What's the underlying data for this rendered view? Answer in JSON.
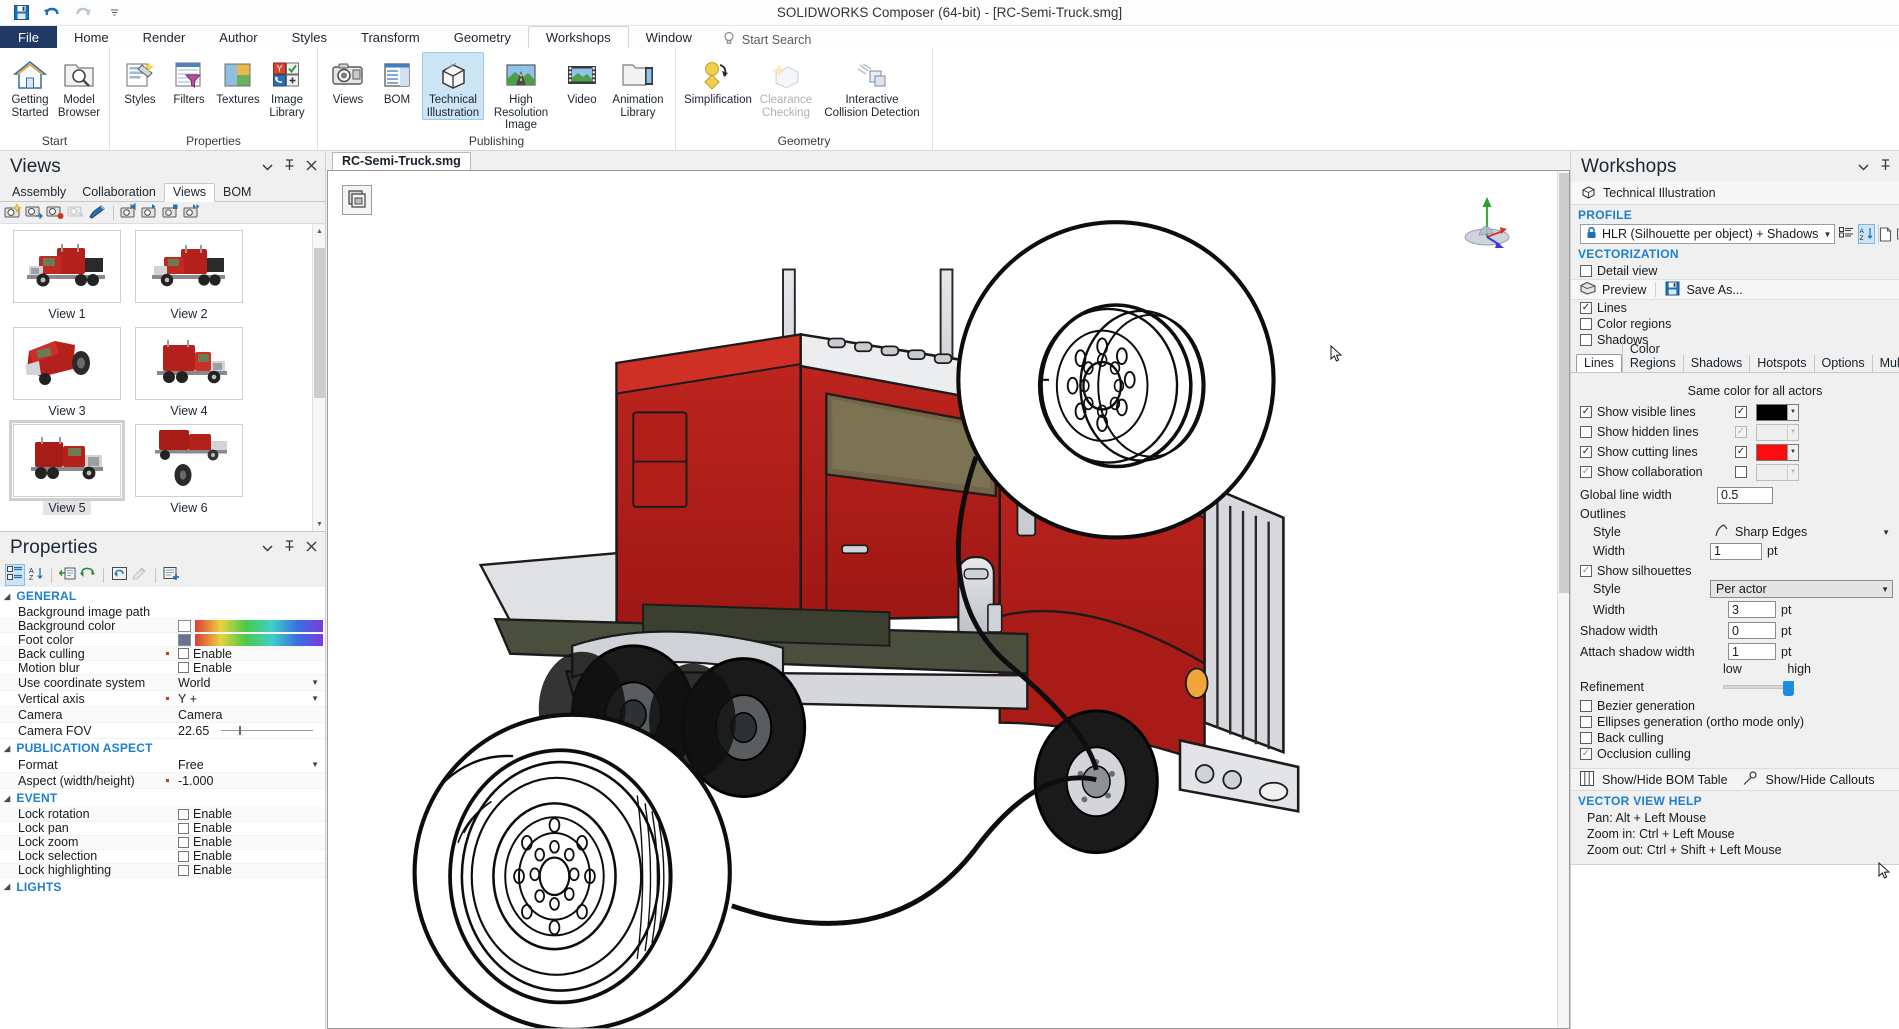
{
  "app": {
    "title": "SOLIDWORKS Composer (64-bit) - [RC-Semi-Truck.smg]",
    "quick_access": [
      "save-icon",
      "undo-icon",
      "redo-icon",
      "customize-qat-icon"
    ]
  },
  "ribbon": {
    "tabs": [
      {
        "label": "File",
        "type": "file"
      },
      {
        "label": "Home"
      },
      {
        "label": "Render"
      },
      {
        "label": "Author"
      },
      {
        "label": "Styles"
      },
      {
        "label": "Transform"
      },
      {
        "label": "Geometry"
      },
      {
        "label": "Workshops",
        "active": true
      },
      {
        "label": "Window"
      }
    ],
    "search_placeholder": "Start Search",
    "groups": [
      {
        "label": "Start",
        "buttons": [
          {
            "label": "Getting\nStarted",
            "icon": "home-icon",
            "selected": false,
            "disabled": false
          },
          {
            "label": "Model\nBrowser",
            "icon": "folder-search-icon",
            "selected": false,
            "disabled": false
          }
        ]
      },
      {
        "label": "Properties",
        "buttons": [
          {
            "label": "Styles",
            "icon": "styles-icon",
            "selected": false,
            "disabled": false
          },
          {
            "label": "Filters",
            "icon": "filters-icon",
            "selected": false,
            "disabled": false
          },
          {
            "label": "Textures",
            "icon": "textures-icon",
            "selected": false,
            "disabled": false
          },
          {
            "label": "Image\nLibrary",
            "icon": "image-library-icon",
            "selected": false,
            "disabled": false
          }
        ]
      },
      {
        "label": "Publishing",
        "buttons": [
          {
            "label": "Views",
            "icon": "camera-icon",
            "selected": false,
            "disabled": false
          },
          {
            "label": "BOM",
            "icon": "bom-icon",
            "selected": false,
            "disabled": false
          },
          {
            "label": "Technical\nIllustration",
            "icon": "technical-illustration-icon",
            "selected": true,
            "disabled": false
          },
          {
            "label": "High Resolution\nImage",
            "icon": "high-res-image-icon",
            "selected": false,
            "disabled": false
          },
          {
            "label": "Video",
            "icon": "video-icon",
            "selected": false,
            "disabled": false
          },
          {
            "label": "Animation\nLibrary",
            "icon": "animation-library-icon",
            "selected": false,
            "disabled": false
          }
        ]
      },
      {
        "label": "Geometry",
        "buttons": [
          {
            "label": "Simplification",
            "icon": "simplification-icon",
            "selected": false,
            "disabled": false
          },
          {
            "label": "Clearance\nChecking",
            "icon": "clearance-checking-icon",
            "selected": false,
            "disabled": true
          },
          {
            "label": "Interactive\nCollision Detection",
            "icon": "collision-detection-icon",
            "selected": false,
            "disabled": true
          }
        ]
      }
    ]
  },
  "views_panel": {
    "title": "Views",
    "tabs": [
      {
        "label": "Assembly",
        "active": false
      },
      {
        "label": "Collaboration",
        "active": false
      },
      {
        "label": "Views",
        "active": true
      },
      {
        "label": "BOM",
        "active": false
      }
    ],
    "toolbar": [
      "create-view-icon",
      "update-view-icon",
      "record-view-icon",
      "refresh-view-icon",
      "paint-view-icon",
      "first-view-icon",
      "previous-view-icon",
      "stop-view-icon",
      "next-view-icon"
    ],
    "thumbnails": [
      {
        "label": "View 1",
        "selected": false,
        "kind": "truck-front-quarter"
      },
      {
        "label": "View 2",
        "selected": false,
        "kind": "truck-front-quarter"
      },
      {
        "label": "View 3",
        "selected": false,
        "kind": "truck-with-wheel-off"
      },
      {
        "label": "View 4",
        "selected": false,
        "kind": "truck-side"
      },
      {
        "label": "View 5",
        "selected": true,
        "kind": "truck-rear-quarter"
      },
      {
        "label": "View 6",
        "selected": false,
        "kind": "truck-with-tire"
      }
    ]
  },
  "properties_panel": {
    "title": "Properties",
    "toolbar": [
      "group-by-category-icon",
      "sort-alpha-icon",
      "import-properties-icon",
      "refresh-properties-icon",
      "restore-default-icon",
      "eyedropper-icon",
      "add-property-icon"
    ],
    "groups": [
      {
        "name": "GENERAL",
        "rows": [
          {
            "name": "Background image path",
            "value": "",
            "type": "text",
            "modified": false
          },
          {
            "name": "Background color",
            "value": "",
            "type": "color",
            "swatch": "#ffffff",
            "modified": false
          },
          {
            "name": "Foot color",
            "value": "",
            "type": "color",
            "swatch": "#6b7190",
            "modified": false
          },
          {
            "name": "Back culling",
            "value": "Enable",
            "type": "checkbox",
            "checked": false,
            "modified": true
          },
          {
            "name": "Motion blur",
            "value": "Enable",
            "type": "checkbox",
            "checked": false,
            "modified": false
          },
          {
            "name": "Use coordinate system",
            "value": "World",
            "type": "dropdown",
            "modified": false
          },
          {
            "name": "Vertical axis",
            "value": "Y +",
            "type": "dropdown",
            "modified": true
          },
          {
            "name": "Camera",
            "value": "Camera",
            "type": "text",
            "modified": false
          },
          {
            "name": "Camera FOV",
            "value": "22.65",
            "type": "slider",
            "modified": false
          }
        ]
      },
      {
        "name": "PUBLICATION ASPECT",
        "rows": [
          {
            "name": "Format",
            "value": "Free",
            "type": "dropdown",
            "modified": false
          },
          {
            "name": "Aspect (width/height)",
            "value": "-1.000",
            "type": "text",
            "modified": true
          }
        ]
      },
      {
        "name": "EVENT",
        "rows": [
          {
            "name": "Lock rotation",
            "value": "Enable",
            "type": "checkbox",
            "checked": false,
            "modified": false
          },
          {
            "name": "Lock pan",
            "value": "Enable",
            "type": "checkbox",
            "checked": false,
            "modified": false
          },
          {
            "name": "Lock zoom",
            "value": "Enable",
            "type": "checkbox",
            "checked": false,
            "modified": false
          },
          {
            "name": "Lock selection",
            "value": "Enable",
            "type": "checkbox",
            "checked": false,
            "modified": false
          },
          {
            "name": "Lock highlighting",
            "value": "Enable",
            "type": "checkbox",
            "checked": false,
            "modified": false
          }
        ]
      },
      {
        "name": "LIGHTS",
        "rows": []
      }
    ]
  },
  "viewport": {
    "document_tab": "RC-Semi-Truck.smg",
    "corner_button": "view-mode-icon",
    "axis_indicator": "coordinate-axis-icon"
  },
  "workshops": {
    "title": "Workshops",
    "subtitle": "Technical Illustration",
    "subtitle_icon": "technical-illustration-icon",
    "profile_section": "PROFILE",
    "profile_value": "HLR (Silhouette per object) + Shadows",
    "profile_locked_icon": "lock-icon",
    "profile_buttons": [
      {
        "name": "manage-profiles-icon",
        "active": false
      },
      {
        "name": "sort-profiles-icon",
        "active": true
      },
      {
        "name": "new-profile-icon",
        "active": false
      },
      {
        "name": "duplicate-profile-icon",
        "active": false
      },
      {
        "name": "delete-profile-icon",
        "active": false
      }
    ],
    "vectorization_section": "VECTORIZATION",
    "detail_view": {
      "label": "Detail view",
      "checked": false
    },
    "preview_label": "Preview",
    "save_as_label": "Save As...",
    "output_options": [
      {
        "label": "Lines",
        "checked": true
      },
      {
        "label": "Color regions",
        "checked": false
      },
      {
        "label": "Shadows",
        "checked": false
      }
    ],
    "tabs": [
      {
        "label": "Lines",
        "active": true
      },
      {
        "label": "Color Regions",
        "active": false
      },
      {
        "label": "Shadows",
        "active": false
      },
      {
        "label": "Hotspots",
        "active": false
      },
      {
        "label": "Options",
        "active": false
      },
      {
        "label": "Multiple",
        "active": false
      }
    ],
    "same_color_label": "Same color for all actors",
    "line_rows": [
      {
        "label": "Show visible lines",
        "checked": true,
        "color_checked": true,
        "color": "#000000",
        "disabled": false
      },
      {
        "label": "Show hidden lines",
        "checked": false,
        "color_checked": true,
        "color": "#eeeeee",
        "disabled": true
      },
      {
        "label": "Show cutting lines",
        "checked": true,
        "color_checked": true,
        "color": "#fc0d0d",
        "disabled": false
      },
      {
        "label": "Show collaboration",
        "checked": true,
        "color_checked": false,
        "color": "#eeeeee",
        "disabled": true
      }
    ],
    "global_line_width": {
      "label": "Global line width",
      "value": "0.5"
    },
    "outlines": {
      "label": "Outlines",
      "style_label": "Style",
      "style_value": "Sharp Edges",
      "style_icon": "sharp-edges-icon",
      "width_label": "Width",
      "width_value": "1",
      "unit": "pt"
    },
    "silhouettes": {
      "label": "Show silhouettes",
      "checked": true,
      "style_label": "Style",
      "style_value": "Per actor",
      "width_label": "Width",
      "width_value": "3",
      "unit": "pt"
    },
    "shadow_width": {
      "label": "Shadow width",
      "value": "0",
      "unit": "pt"
    },
    "attach_shadow_width": {
      "label": "Attach shadow width",
      "value": "1",
      "unit": "pt"
    },
    "refinement": {
      "label": "Refinement",
      "low": "low",
      "high": "high",
      "value": 100
    },
    "generation_options": [
      {
        "label": "Bezier generation",
        "checked": false
      },
      {
        "label": "Ellipses generation (ortho mode only)",
        "checked": false
      },
      {
        "label": "Back culling",
        "checked": false
      },
      {
        "label": "Occlusion culling",
        "checked": true
      }
    ],
    "bom_bar": {
      "table_label": "Show/Hide BOM Table",
      "table_icon": "bom-table-icon",
      "callouts_label": "Show/Hide Callouts",
      "callouts_icon": "callout-icon"
    },
    "help_section": "VECTOR VIEW HELP",
    "help_lines": [
      "Pan: Alt + Left Mouse",
      "Zoom in: Ctrl + Left Mouse",
      "Zoom out: Ctrl + Shift + Left Mouse"
    ]
  },
  "colors": {
    "accent_blue": "#1e7fd0",
    "file_tab_blue": "#1f3864",
    "selection_blue": "#cde6f7",
    "truck_red": "#b4201c",
    "truck_red_dark": "#8a1512",
    "truck_chrome": "#d2d4d8"
  }
}
